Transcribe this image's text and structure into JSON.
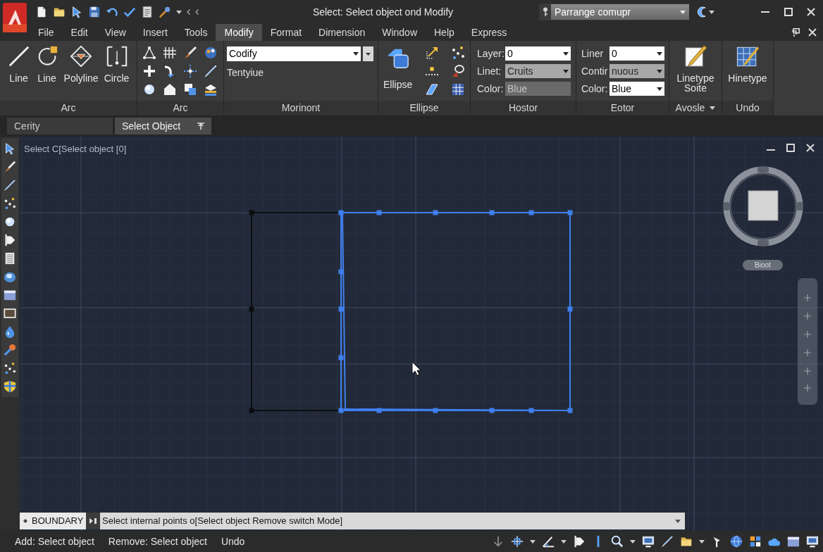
{
  "title_bar": {
    "title": "Select: Select object ond Modify",
    "search": {
      "value": "Parrange comupr"
    }
  },
  "menu": [
    {
      "label": "File",
      "selected": false
    },
    {
      "label": "Edit",
      "selected": false
    },
    {
      "label": "View",
      "selected": false
    },
    {
      "label": "Insert",
      "selected": false
    },
    {
      "label": "Tools",
      "selected": false
    },
    {
      "label": "Modify",
      "selected": true
    },
    {
      "label": "Format",
      "selected": false
    },
    {
      "label": "Dimension",
      "selected": false
    },
    {
      "label": "Window",
      "selected": false
    },
    {
      "label": "Help",
      "selected": false
    },
    {
      "label": "Express",
      "selected": false
    }
  ],
  "ribbon": {
    "panels": [
      {
        "kind": "large",
        "title": "Arc",
        "tools": [
          {
            "label": "Line"
          },
          {
            "label": "Line"
          },
          {
            "label": "Polyline"
          },
          {
            "label": "Circle"
          }
        ]
      },
      {
        "kind": "grid",
        "title": "Arc"
      },
      {
        "kind": "combo",
        "title": "Morinont",
        "combo": {
          "value": "Codify"
        },
        "note": "Tentyiue"
      },
      {
        "kind": "large_grid",
        "title": "Ellipse",
        "tools": [
          {
            "label": "Ellipse"
          }
        ]
      },
      {
        "kind": "properties",
        "title": "Hostor",
        "rows": [
          {
            "label": "Layer:",
            "value": "0",
            "kind": "dropdown",
            "disabled": false
          },
          {
            "label": "Linet:",
            "value": "Cruits",
            "kind": "dropdown",
            "disabled": true
          },
          {
            "label": "Color:",
            "value": "Blue",
            "kind": "readonly",
            "disabled": true
          }
        ]
      },
      {
        "kind": "properties",
        "title": "Eotor",
        "rows": [
          {
            "label": "Liner",
            "value": "0",
            "kind": "dropdown",
            "disabled": false
          },
          {
            "label": "Contir",
            "value": "nuous",
            "kind": "dropdown",
            "disabled": true
          },
          {
            "label": "Color:",
            "value": "Blue",
            "kind": "dropdown",
            "disabled": false
          }
        ]
      },
      {
        "kind": "large",
        "title": "Avosle",
        "menu": true,
        "tools": [
          {
            "label": "Linetype Soite"
          }
        ]
      },
      {
        "kind": "large",
        "title": "Undo",
        "tools": [
          {
            "label": "Hinetype"
          }
        ]
      }
    ]
  },
  "doc_tabs": [
    {
      "label": "Cerity",
      "selected": false
    },
    {
      "label": "Select Object",
      "selected": true
    }
  ],
  "canvas": {
    "prompt": "Select C[Select object [0]",
    "shapes": [
      {
        "kind": "polyline",
        "selected": false
      },
      {
        "kind": "rectangle",
        "selected": true
      }
    ],
    "viewcube": {
      "button": "Bioot"
    }
  },
  "command_line": {
    "label": "BOUNDARY",
    "input": {
      "value": "Select internal points o[Select object Remove switch Mode]"
    }
  },
  "status_bar": {
    "options": [
      "Add: Select object",
      "Remove: Select object",
      "Undo"
    ]
  }
}
